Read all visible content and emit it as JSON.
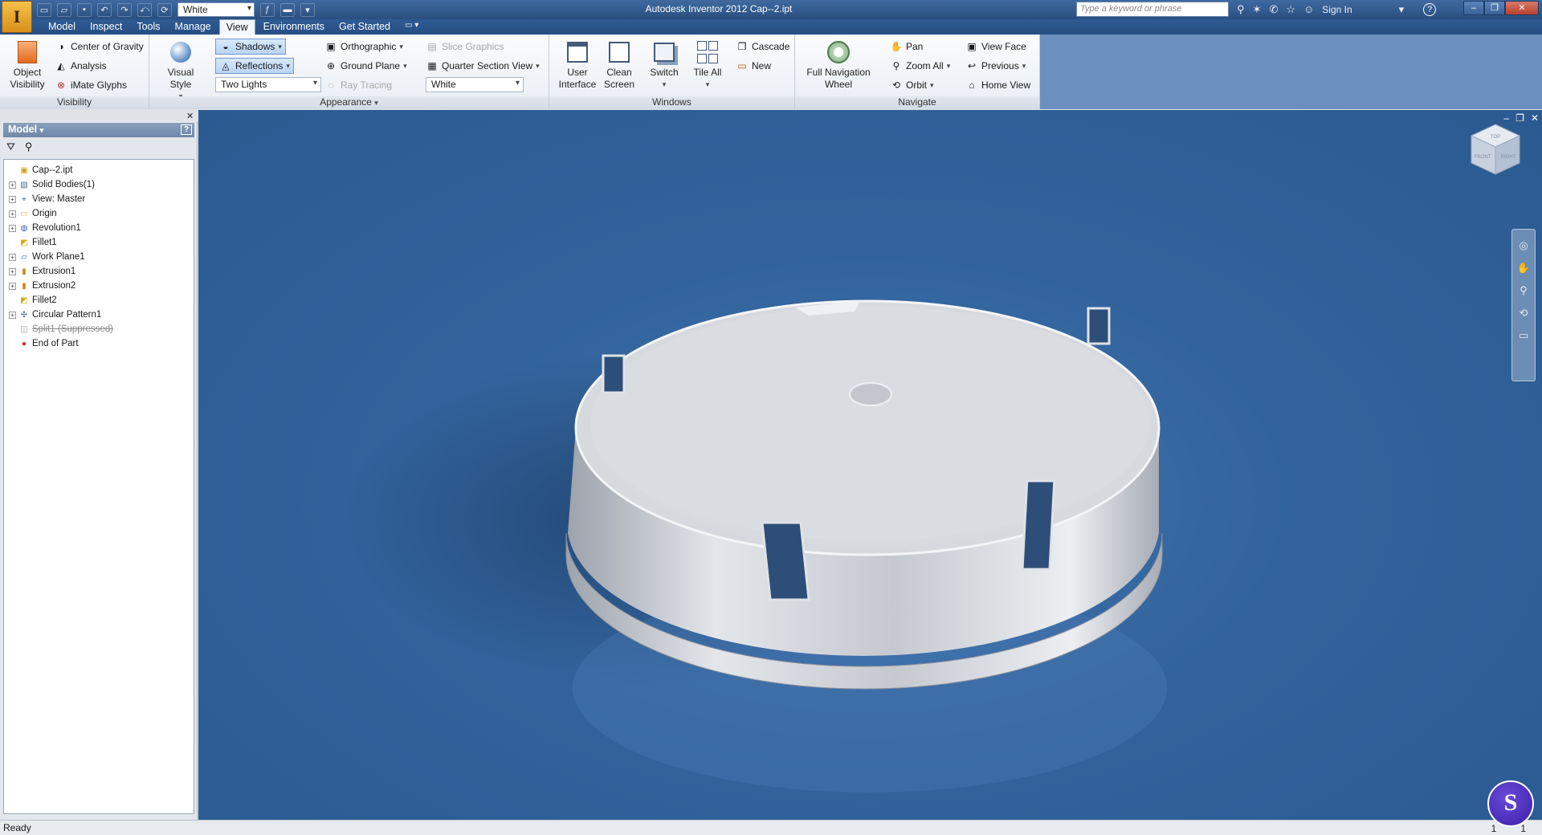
{
  "titlebar": {
    "app_logo": "I",
    "title": "Autodesk Inventor 2012    Cap--2.ipt",
    "color_combo": "White",
    "search_placeholder": "Type a keyword or phrase",
    "signin": "Sign In",
    "help": "?"
  },
  "tabs": [
    "Model",
    "Inspect",
    "Tools",
    "Manage",
    "View",
    "Environments",
    "Get Started"
  ],
  "active_tab": "View",
  "ribbon": {
    "visibility": {
      "title": "Visibility",
      "object_visibility": "Object Visibility",
      "center_gravity": "Center of Gravity",
      "analysis": "Analysis",
      "imate": "iMate Glyphs"
    },
    "appearance": {
      "title": "Appearance",
      "visual_style": "Visual Style",
      "shadows": "Shadows",
      "reflections": "Reflections",
      "lights_combo": "Two Lights",
      "orthographic": "Orthographic",
      "ground_plane": "Ground Plane",
      "ray_tracing": "Ray Tracing",
      "slice_graphics": "Slice Graphics",
      "quarter_section": "Quarter Section View",
      "color_combo": "White"
    },
    "windows": {
      "title": "Windows",
      "user_interface": "User Interface",
      "clean_screen": "Clean Screen",
      "switch": "Switch",
      "tile_all": "Tile All",
      "cascade": "Cascade",
      "new": "New"
    },
    "navigate": {
      "title": "Navigate",
      "full_nav_wheel": "Full Navigation Wheel",
      "pan": "Pan",
      "zoom_all": "Zoom All",
      "orbit": "Orbit",
      "view_face": "View Face",
      "previous": "Previous",
      "home_view": "Home View"
    }
  },
  "browser": {
    "title": "Model",
    "tree": [
      {
        "label": "Cap--2.ipt",
        "icon": "part-icon",
        "expand": false
      },
      {
        "label": "Solid Bodies(1)",
        "icon": "solid-bodies-icon",
        "expand": true
      },
      {
        "label": "View: Master",
        "icon": "view-icon",
        "expand": true
      },
      {
        "label": "Origin",
        "icon": "folder-icon",
        "expand": true
      },
      {
        "label": "Revolution1",
        "icon": "revolution-icon",
        "expand": true
      },
      {
        "label": "Fillet1",
        "icon": "fillet-icon",
        "expand": false
      },
      {
        "label": "Work Plane1",
        "icon": "workplane-icon",
        "expand": true
      },
      {
        "label": "Extrusion1",
        "icon": "extrusion-icon",
        "expand": true
      },
      {
        "label": "Extrusion2",
        "icon": "extrusion-icon",
        "expand": true
      },
      {
        "label": "Fillet2",
        "icon": "fillet-icon",
        "expand": false
      },
      {
        "label": "Circular Pattern1",
        "icon": "pattern-icon",
        "expand": true
      },
      {
        "label": "Split1 (Suppressed)",
        "icon": "split-icon",
        "expand": false,
        "suppressed": true
      },
      {
        "label": "End of Part",
        "icon": "end-of-part-icon",
        "expand": false
      }
    ]
  },
  "viewcube": {
    "top": "TOP",
    "front": "FRONT",
    "right": "RIGHT"
  },
  "status": {
    "text": "Ready",
    "count1": "1",
    "count2": "1"
  },
  "widget_letter": "S"
}
